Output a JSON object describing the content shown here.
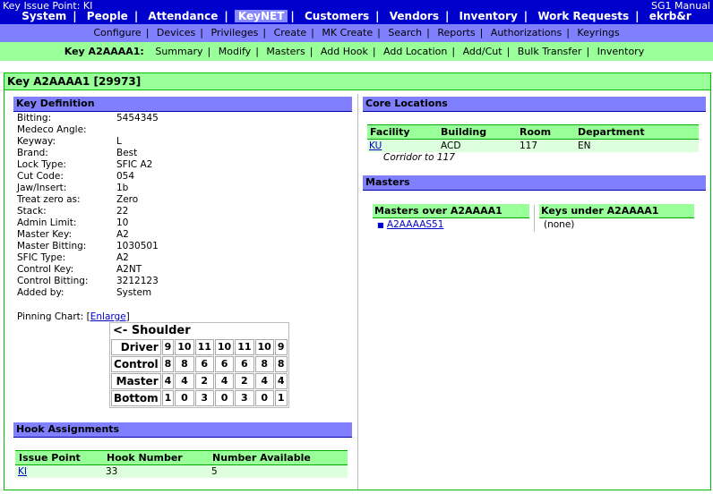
{
  "top": {
    "key_issue_point": "Key Issue Point: KI",
    "manual": "SG1 Manual",
    "nav": [
      {
        "label": "System",
        "active": false
      },
      {
        "label": "People",
        "active": false
      },
      {
        "label": "Attendance",
        "active": false
      },
      {
        "label": "KeyNET",
        "active": true
      },
      {
        "label": "Customers",
        "active": false
      },
      {
        "label": "Vendors",
        "active": false
      },
      {
        "label": "Inventory",
        "active": false
      },
      {
        "label": "Work Requests",
        "active": false
      },
      {
        "label": "ekrb&r",
        "active": false
      }
    ]
  },
  "subnav": [
    "Configure",
    "Devices",
    "Privileges",
    "Create",
    "MK Create",
    "Search",
    "Reports",
    "Authorizations",
    "Keyrings"
  ],
  "keynav": {
    "label": "Key A2AAAA1:",
    "items": [
      "Summary",
      "Modify",
      "Masters",
      "Add Hook",
      "Add Location",
      "Add/Cut",
      "Bulk Transfer",
      "Inventory"
    ]
  },
  "page_title": "Key A2AAAA1 [29973]",
  "key_definition": {
    "title": "Key Definition",
    "rows": [
      {
        "label": "Bitting:",
        "value": "5454345"
      },
      {
        "label": "Medeco Angle:",
        "value": ""
      },
      {
        "label": "Keyway:",
        "value": "L"
      },
      {
        "label": "Brand:",
        "value": "Best"
      },
      {
        "label": "Lock Type:",
        "value": "SFIC A2"
      },
      {
        "label": "Cut Code:",
        "value": "054"
      },
      {
        "label": "Jaw/Insert:",
        "value": "1b"
      },
      {
        "label": "Treat zero as:",
        "value": "Zero"
      },
      {
        "label": "Stack:",
        "value": "22"
      },
      {
        "label": "Admin Limit:",
        "value": "10"
      },
      {
        "label": "Master Key:",
        "value": "A2"
      },
      {
        "label": "Master Bitting:",
        "value": "1030501"
      },
      {
        "label": "SFIC Type:",
        "value": "A2"
      },
      {
        "label": "Control Key:",
        "value": "A2NT"
      },
      {
        "label": "Control Bitting:",
        "value": "3212123"
      },
      {
        "label": "Added by:",
        "value": "System"
      }
    ]
  },
  "pinning": {
    "label": "Pinning Chart:",
    "bracket_open": "[",
    "enlarge": "Enlarge",
    "bracket_close": "]",
    "shoulder": "<- Shoulder",
    "rows": [
      {
        "name": "Driver",
        "pins": [
          "9",
          "10",
          "11",
          "10",
          "11",
          "10",
          "9"
        ]
      },
      {
        "name": "Control",
        "pins": [
          "8",
          "8",
          "6",
          "6",
          "6",
          "8",
          "8"
        ]
      },
      {
        "name": "Master",
        "pins": [
          "4",
          "4",
          "2",
          "4",
          "2",
          "4",
          "4"
        ]
      },
      {
        "name": "Bottom",
        "pins": [
          "1",
          "0",
          "3",
          "0",
          "3",
          "0",
          "1"
        ]
      }
    ]
  },
  "hooks": {
    "title": "Hook Assignments",
    "headers": [
      "Issue Point",
      "Hook Number",
      "Number Available"
    ],
    "row": {
      "issue_point": "KI",
      "hook_number": "33",
      "available": "5"
    }
  },
  "core_locations": {
    "title": "Core Locations",
    "headers": [
      "Facility",
      "Building",
      "Room",
      "Department"
    ],
    "row": {
      "facility": "KU",
      "building": "ACD",
      "room": "117",
      "department": "EN"
    },
    "note": "Corridor to 117"
  },
  "masters": {
    "title": "Masters",
    "over_header": "Masters over A2AAAA1",
    "over_bullet": "■",
    "over_item": "A2AAAAS51",
    "under_header": "Keys under A2AAAA1",
    "under_item": "(none)"
  }
}
